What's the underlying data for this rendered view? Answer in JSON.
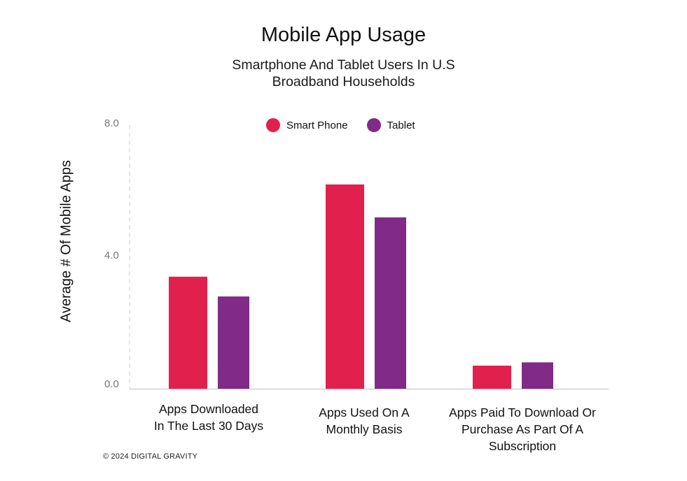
{
  "chart_data": {
    "type": "bar",
    "title": "Mobile App Usage",
    "subtitle": [
      "Smartphone And Tablet Users In U.S",
      "Broadband Households"
    ],
    "xlabel": "",
    "ylabel": "Average # Of Mobile Apps",
    "ylim": [
      0,
      8
    ],
    "yticks": [
      "0.0",
      "4.0",
      "8.0"
    ],
    "ytick_values": [
      0,
      4,
      8
    ],
    "grid": false,
    "legend_position": "top-center",
    "categories": [
      [
        "Apps Downloaded",
        "In The Last 30 Days"
      ],
      [
        "Apps Used On A",
        "Monthly Basis"
      ],
      [
        "Apps Paid To Download Or",
        "Purchase As Part Of A",
        "Subscription"
      ]
    ],
    "series": [
      {
        "name": "Smart Phone",
        "color": "#E2204E",
        "values": [
          3.4,
          6.2,
          0.7
        ]
      },
      {
        "name": "Tablet",
        "color": "#822A88",
        "values": [
          2.8,
          5.2,
          0.8
        ]
      }
    ]
  },
  "footer": "© 2024 DIGITAL GRAVITY"
}
